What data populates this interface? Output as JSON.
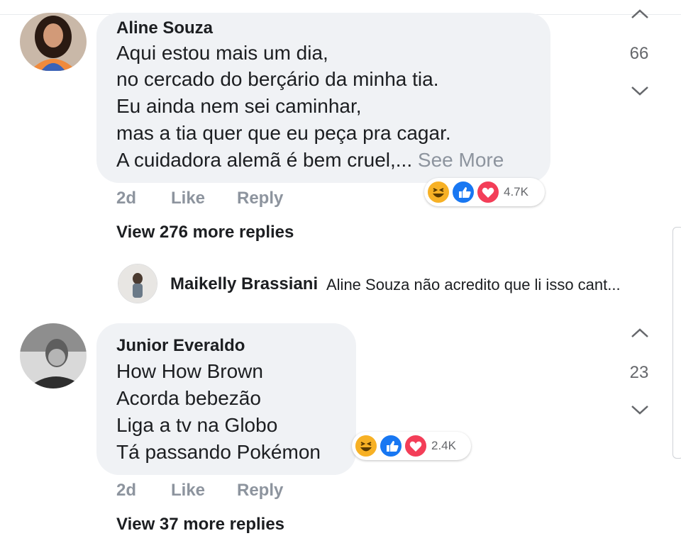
{
  "comments": [
    {
      "author": "Aline Souza",
      "lines": [
        "Aqui estou mais um dia,",
        "no cercado do berçário da minha tia.",
        "Eu ainda nem sei caminhar,",
        "mas a tia quer que eu peça pra cagar.",
        "A cuidadora alemã é bem cruel,..."
      ],
      "see_more": "See More",
      "time": "2d",
      "like_label": "Like",
      "reply_label": "Reply",
      "reaction_count": "4.7K",
      "reactions": [
        "haha-icon",
        "like-icon",
        "love-icon"
      ],
      "vote_count": "66",
      "view_more": "View 276 more replies",
      "reply_preview": {
        "author": "Maikelly Brassiani",
        "text": "Aline Souza não acredito que li isso cant..."
      }
    },
    {
      "author": "Junior Everaldo",
      "lines": [
        "How How Brown",
        "Acorda bebezão",
        "Liga a tv na Globo",
        "Tá passando Pokémon"
      ],
      "time": "2d",
      "like_label": "Like",
      "reply_label": "Reply",
      "reaction_count": "2.4K",
      "reactions": [
        "haha-icon",
        "like-icon",
        "love-icon"
      ],
      "vote_count": "23",
      "view_more": "View 37 more replies"
    }
  ],
  "colors": {
    "bubble": "#f0f2f5",
    "meta_text": "#8d949e",
    "like_blue": "#1877f2",
    "love_red": "#f33e58",
    "haha_yellow": "#f7b125"
  }
}
